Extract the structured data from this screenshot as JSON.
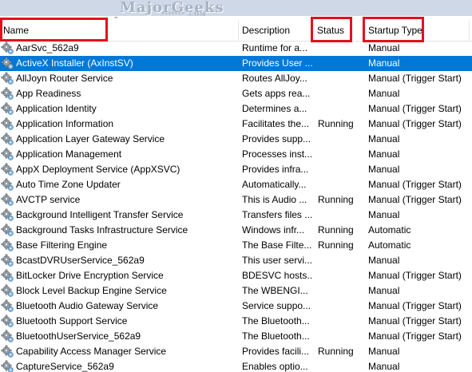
{
  "watermark": {
    "brand_label": "MajorGeeks",
    "sub_label": "******* .COM"
  },
  "columns": {
    "name": "Name",
    "description": "Description",
    "status": "Status",
    "startup_type": "Startup Type"
  },
  "icons": {
    "service": "gear-icon",
    "sort": "chevron-up-icon"
  },
  "colors": {
    "selection": "#0078d7",
    "callout": "#e3101d"
  },
  "services": [
    {
      "name": "AarSvc_562a9",
      "description": "Runtime for a...",
      "status": "",
      "startup_type": "Manual"
    },
    {
      "name": "ActiveX Installer (AxInstSV)",
      "description": "Provides User ...",
      "status": "",
      "startup_type": "Manual",
      "selected": true
    },
    {
      "name": "AllJoyn Router Service",
      "description": "Routes AllJoy...",
      "status": "",
      "startup_type": "Manual (Trigger Start)"
    },
    {
      "name": "App Readiness",
      "description": "Gets apps rea...",
      "status": "",
      "startup_type": "Manual"
    },
    {
      "name": "Application Identity",
      "description": "Determines a...",
      "status": "",
      "startup_type": "Manual (Trigger Start)"
    },
    {
      "name": "Application Information",
      "description": "Facilitates the...",
      "status": "Running",
      "startup_type": "Manual (Trigger Start)"
    },
    {
      "name": "Application Layer Gateway Service",
      "description": "Provides supp...",
      "status": "",
      "startup_type": "Manual"
    },
    {
      "name": "Application Management",
      "description": "Processes inst...",
      "status": "",
      "startup_type": "Manual"
    },
    {
      "name": "AppX Deployment Service (AppXSVC)",
      "description": "Provides infra...",
      "status": "",
      "startup_type": "Manual"
    },
    {
      "name": "Auto Time Zone Updater",
      "description": "Automatically...",
      "status": "",
      "startup_type": "Manual (Trigger Start)"
    },
    {
      "name": "AVCTP service",
      "description": "This is Audio ...",
      "status": "Running",
      "startup_type": "Manual (Trigger Start)"
    },
    {
      "name": "Background Intelligent Transfer Service",
      "description": "Transfers files ...",
      "status": "",
      "startup_type": "Manual"
    },
    {
      "name": "Background Tasks Infrastructure Service",
      "description": "Windows infr...",
      "status": "Running",
      "startup_type": "Automatic"
    },
    {
      "name": "Base Filtering Engine",
      "description": "The Base Filte...",
      "status": "Running",
      "startup_type": "Automatic"
    },
    {
      "name": "BcastDVRUserService_562a9",
      "description": "This user servi...",
      "status": "",
      "startup_type": "Manual"
    },
    {
      "name": "BitLocker Drive Encryption Service",
      "description": "BDESVC hosts...",
      "status": "",
      "startup_type": "Manual (Trigger Start)"
    },
    {
      "name": "Block Level Backup Engine Service",
      "description": "The WBENGI...",
      "status": "",
      "startup_type": "Manual"
    },
    {
      "name": "Bluetooth Audio Gateway Service",
      "description": "Service suppo...",
      "status": "",
      "startup_type": "Manual (Trigger Start)"
    },
    {
      "name": "Bluetooth Support Service",
      "description": "The Bluetooth...",
      "status": "",
      "startup_type": "Manual (Trigger Start)"
    },
    {
      "name": "BluetoothUserService_562a9",
      "description": "The Bluetooth...",
      "status": "",
      "startup_type": "Manual (Trigger Start)"
    },
    {
      "name": "Capability Access Manager Service",
      "description": "Provides facili...",
      "status": "Running",
      "startup_type": "Manual"
    },
    {
      "name": "CaptureService_562a9",
      "description": "Enables optio...",
      "status": "",
      "startup_type": "Manual"
    }
  ]
}
